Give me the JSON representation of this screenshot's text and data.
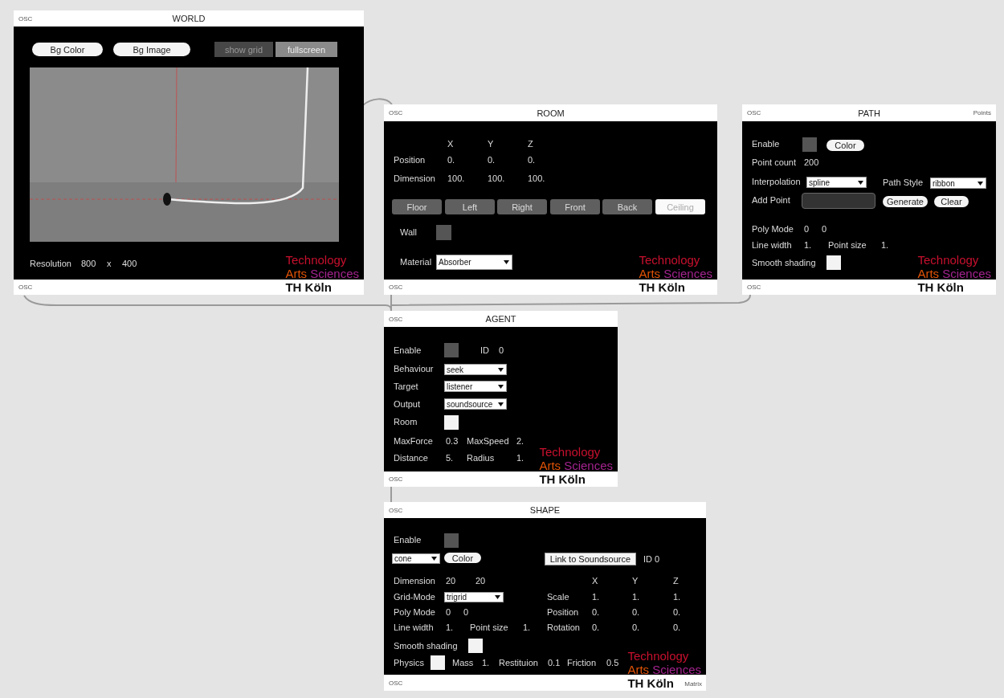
{
  "panels": [
    {
      "title": "WORLD",
      "osc_top": "OSC",
      "osc_bottom": "OSC",
      "logo": {
        "line1": "Technology",
        "word_a": "Arts",
        "word_b": "Sciences",
        "footer": "TH Köln"
      },
      "items": [
        {
          "kind": "pill",
          "label": "Bg Color"
        },
        {
          "kind": "pill",
          "label": "Bg Image"
        },
        {
          "kind": "flat",
          "label": "show grid",
          "on": false
        },
        {
          "kind": "flat",
          "label": "fullscreen",
          "on": true
        },
        {
          "kind": "view"
        },
        {
          "kind": "text",
          "text": "Resolution"
        },
        {
          "kind": "text",
          "text": "800"
        },
        {
          "kind": "text",
          "text": "x"
        },
        {
          "kind": "text",
          "text": "400"
        }
      ]
    },
    {
      "title": "ROOM",
      "osc_top": "OSC",
      "osc_bottom": "OSC",
      "logo": {
        "line1": "Technology",
        "word_a": "Arts",
        "word_b": "Sciences",
        "footer": "TH Köln"
      },
      "items": [
        {
          "kind": "text",
          "text": "X"
        },
        {
          "kind": "text",
          "text": "Y"
        },
        {
          "kind": "text",
          "text": "Z"
        },
        {
          "kind": "text",
          "text": "Position"
        },
        {
          "kind": "text",
          "text": "0."
        },
        {
          "kind": "text",
          "text": "0."
        },
        {
          "kind": "text",
          "text": "0."
        },
        {
          "kind": "text",
          "text": "Dimension"
        },
        {
          "kind": "text",
          "text": "100."
        },
        {
          "kind": "text",
          "text": "100."
        },
        {
          "kind": "text",
          "text": "100."
        },
        {
          "kind": "tab",
          "label": "Floor",
          "selected": false
        },
        {
          "kind": "tab",
          "label": "Left",
          "selected": false
        },
        {
          "kind": "tab",
          "label": "Right",
          "selected": false
        },
        {
          "kind": "tab",
          "label": "Front",
          "selected": false
        },
        {
          "kind": "tab",
          "label": "Back",
          "selected": false
        },
        {
          "kind": "tab",
          "label": "Ceiling",
          "selected": true
        },
        {
          "kind": "text",
          "text": "Wall"
        },
        {
          "kind": "toggle",
          "on": false
        },
        {
          "kind": "text",
          "text": "Material"
        },
        {
          "kind": "dropdown",
          "value": "Absorber"
        }
      ]
    },
    {
      "title": "PATH",
      "osc_top": "OSC",
      "osc_bottom": "OSC",
      "corner": "Points",
      "logo": {
        "line1": "Technology",
        "word_a": "Arts",
        "word_b": "Sciences",
        "footer": "TH Köln"
      },
      "items": [
        {
          "kind": "text",
          "text": "Enable"
        },
        {
          "kind": "toggle",
          "on": false
        },
        {
          "kind": "pill",
          "label": "Color"
        },
        {
          "kind": "text",
          "text": "Point count"
        },
        {
          "kind": "text",
          "text": "200"
        },
        {
          "kind": "text",
          "text": "Interpolation"
        },
        {
          "kind": "dropdown",
          "value": "spline"
        },
        {
          "kind": "text",
          "text": "Path Style"
        },
        {
          "kind": "dropdown",
          "value": "ribbon"
        },
        {
          "kind": "text",
          "text": "Add Point"
        },
        {
          "kind": "field"
        },
        {
          "kind": "pill",
          "label": "Generate"
        },
        {
          "kind": "pill",
          "label": "Clear"
        },
        {
          "kind": "text",
          "text": "Poly Mode"
        },
        {
          "kind": "text",
          "text": "0"
        },
        {
          "kind": "text",
          "text": "0"
        },
        {
          "kind": "text",
          "text": "Line width"
        },
        {
          "kind": "text",
          "text": "1."
        },
        {
          "kind": "text",
          "text": "Point size"
        },
        {
          "kind": "text",
          "text": "1."
        },
        {
          "kind": "text",
          "text": "Smooth shading"
        },
        {
          "kind": "toggle",
          "on": true
        }
      ]
    },
    {
      "title": "AGENT",
      "osc_top": "OSC",
      "osc_bottom": "OSC",
      "logo": {
        "line1": "Technology",
        "word_a": "Arts",
        "word_b": "Sciences",
        "footer": "TH Köln"
      },
      "items": [
        {
          "kind": "text",
          "text": "Enable"
        },
        {
          "kind": "toggle",
          "on": false
        },
        {
          "kind": "text",
          "text": "ID"
        },
        {
          "kind": "text",
          "text": "0"
        },
        {
          "kind": "text",
          "text": "Behaviour"
        },
        {
          "kind": "dropdown",
          "value": "seek"
        },
        {
          "kind": "text",
          "text": "Target"
        },
        {
          "kind": "dropdown",
          "value": "listener"
        },
        {
          "kind": "text",
          "text": "Output"
        },
        {
          "kind": "dropdown",
          "value": "soundsource"
        },
        {
          "kind": "text",
          "text": "Room"
        },
        {
          "kind": "toggle",
          "on": true
        },
        {
          "kind": "text",
          "text": "MaxForce"
        },
        {
          "kind": "text",
          "text": "0.3"
        },
        {
          "kind": "text",
          "text": "MaxSpeed"
        },
        {
          "kind": "text",
          "text": "2."
        },
        {
          "kind": "text",
          "text": "Distance"
        },
        {
          "kind": "text",
          "text": "5."
        },
        {
          "kind": "text",
          "text": "Radius"
        },
        {
          "kind": "text",
          "text": "1."
        }
      ]
    },
    {
      "title": "SHAPE",
      "osc_top": "OSC",
      "osc_bottom": "OSC",
      "footer_corner": "Matrix",
      "logo": {
        "line1": "Technology",
        "word_a": "Arts",
        "word_b": "Sciences",
        "footer": "TH Köln"
      },
      "items": [
        {
          "kind": "text",
          "text": "Enable"
        },
        {
          "kind": "toggle",
          "on": false
        },
        {
          "kind": "dropdown",
          "value": "cone"
        },
        {
          "kind": "pill",
          "label": "Color"
        },
        {
          "kind": "rect",
          "label": "Link to Soundsource"
        },
        {
          "kind": "text",
          "text": "ID 0"
        },
        {
          "kind": "text",
          "text": "Dimension"
        },
        {
          "kind": "text",
          "text": "20"
        },
        {
          "kind": "text",
          "text": "20"
        },
        {
          "kind": "text",
          "text": "X"
        },
        {
          "kind": "text",
          "text": "Y"
        },
        {
          "kind": "text",
          "text": "Z"
        },
        {
          "kind": "text",
          "text": "Grid-Mode"
        },
        {
          "kind": "dropdown",
          "value": "trigrid"
        },
        {
          "kind": "text",
          "text": "Scale"
        },
        {
          "kind": "text",
          "text": "1."
        },
        {
          "kind": "text",
          "text": "1."
        },
        {
          "kind": "text",
          "text": "1."
        },
        {
          "kind": "text",
          "text": "Poly Mode"
        },
        {
          "kind": "text",
          "text": "0"
        },
        {
          "kind": "text",
          "text": "0"
        },
        {
          "kind": "text",
          "text": "Position"
        },
        {
          "kind": "text",
          "text": "0."
        },
        {
          "kind": "text",
          "text": "0."
        },
        {
          "kind": "text",
          "text": "0."
        },
        {
          "kind": "text",
          "text": "Line width"
        },
        {
          "kind": "text",
          "text": "1."
        },
        {
          "kind": "text",
          "text": "Point size"
        },
        {
          "kind": "text",
          "text": "1."
        },
        {
          "kind": "text",
          "text": "Rotation"
        },
        {
          "kind": "text",
          "text": "0."
        },
        {
          "kind": "text",
          "text": "0."
        },
        {
          "kind": "text",
          "text": "0."
        },
        {
          "kind": "text",
          "text": "Smooth shading"
        },
        {
          "kind": "toggle",
          "on": true
        },
        {
          "kind": "text",
          "text": "Physics"
        },
        {
          "kind": "toggle",
          "on": true
        },
        {
          "kind": "text",
          "text": "Mass"
        },
        {
          "kind": "text",
          "text": "1."
        },
        {
          "kind": "text",
          "text": "Restituion"
        },
        {
          "kind": "text",
          "text": "0.1"
        },
        {
          "kind": "text",
          "text": "Friction"
        },
        {
          "kind": "text",
          "text": "0.5"
        }
      ]
    }
  ]
}
